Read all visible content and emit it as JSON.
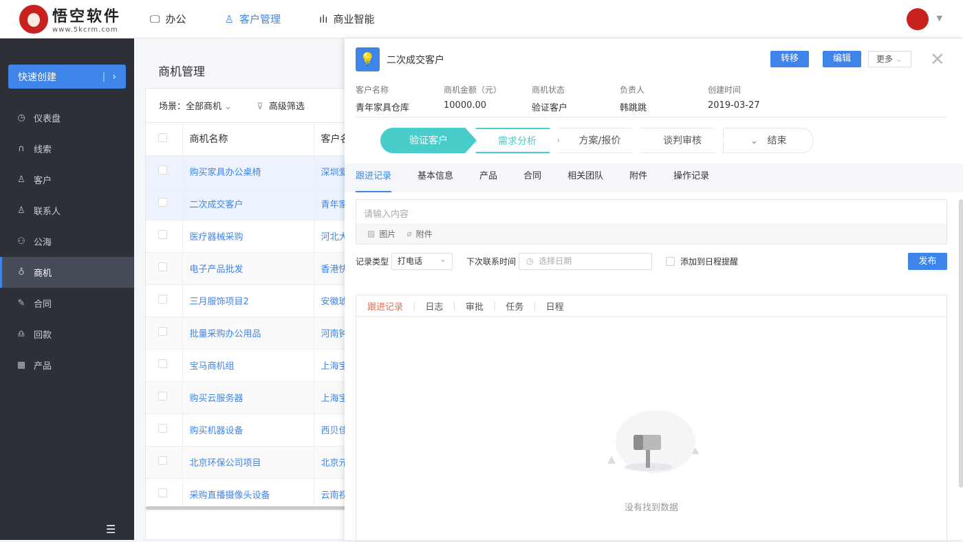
{
  "brand": {
    "name": "悟空软件",
    "url": "www.5kcrm.com"
  },
  "nav": [
    {
      "label": "办公",
      "icon": "monitor-icon"
    },
    {
      "label": "客户管理",
      "icon": "user-icon",
      "active": true
    },
    {
      "label": "商业智能",
      "icon": "bar-chart-icon"
    }
  ],
  "sidebar": {
    "quick_create": "快速创建",
    "items": [
      {
        "label": "仪表盘",
        "icon": "dashboard-icon"
      },
      {
        "label": "线索",
        "icon": "clue-icon"
      },
      {
        "label": "客户",
        "icon": "customer-icon"
      },
      {
        "label": "联系人",
        "icon": "contact-icon"
      },
      {
        "label": "公海",
        "icon": "pool-icon"
      },
      {
        "label": "商机",
        "icon": "bulb-icon",
        "active": true
      },
      {
        "label": "合同",
        "icon": "contract-icon"
      },
      {
        "label": "回款",
        "icon": "money-icon"
      },
      {
        "label": "产品",
        "icon": "product-icon"
      }
    ]
  },
  "list": {
    "title": "商机管理",
    "scene": "场景：全部商机",
    "filter": "高级筛选",
    "columns": [
      "商机名称",
      "客户名"
    ],
    "rows": [
      [
        "购买家具办公桌椅",
        "深圳爱"
      ],
      [
        "二次成交客户",
        "青年家"
      ],
      [
        "医疗器械采购",
        "河北大"
      ],
      [
        "电子产品批发",
        "香港快"
      ],
      [
        "三月服饰项目2",
        "安徽琥"
      ],
      [
        "批量采购办公用品",
        "河南钟"
      ],
      [
        "宝马商机组",
        "上海宝"
      ],
      [
        "购买云服务器",
        "上海宝"
      ],
      [
        "购买机器设备",
        "西贝佳"
      ],
      [
        "北京环保公司项目",
        "北京元"
      ],
      [
        "采购直播摄像头设备",
        "云南视"
      ]
    ]
  },
  "detail": {
    "title": "二次成交客户",
    "buttons": {
      "transfer": "转移",
      "edit": "编辑",
      "more": "更多"
    },
    "fields": [
      {
        "label": "客户名称",
        "value": "青年家具仓库"
      },
      {
        "label": "商机金额（元）",
        "value": "10000.00"
      },
      {
        "label": "商机状态",
        "value": "验证客户"
      },
      {
        "label": "负责人",
        "value": "韩跳跳"
      },
      {
        "label": "创建时间",
        "value": "2019-03-27"
      }
    ],
    "stages": [
      "验证客户",
      "需求分析",
      "方案/报价",
      "谈判审核",
      "结束"
    ],
    "tabs": [
      "跟进记录",
      "基本信息",
      "产品",
      "合同",
      "相关团队",
      "附件",
      "操作记录"
    ],
    "editor": {
      "placeholder": "请输入内容",
      "image": "图片",
      "attachment": "附件"
    },
    "record_type_label": "记录类型",
    "record_type": "打电话",
    "next_contact_label": "下次联系时间",
    "date_placeholder": "选择日期",
    "add_schedule": "添加到日程提醒",
    "publish": "发布",
    "log_tabs": [
      "跟进记录",
      "日志",
      "审批",
      "任务",
      "日程"
    ],
    "empty": "没有找到数据"
  }
}
